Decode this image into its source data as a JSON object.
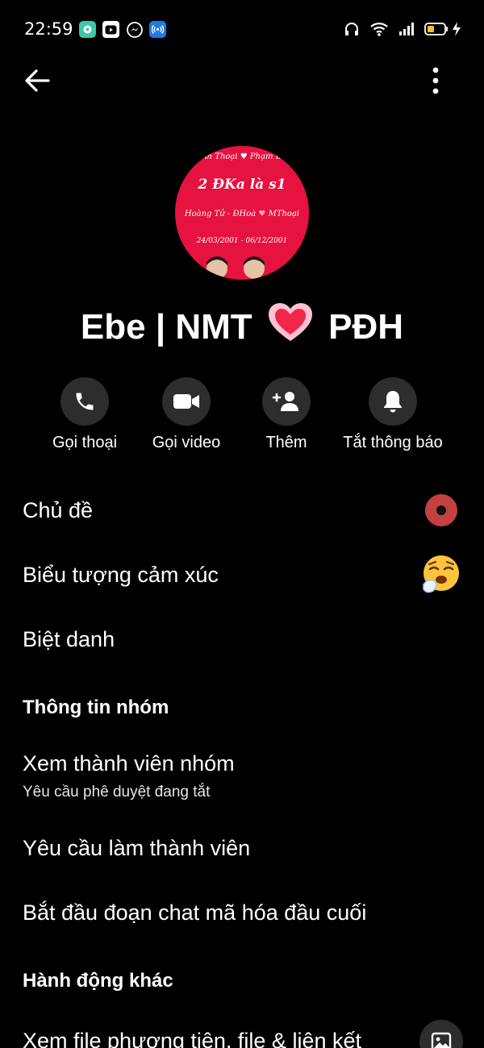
{
  "status_bar": {
    "time": "22:59",
    "notification_icons": [
      "chat-app-icon",
      "youtube-icon",
      "messenger-icon",
      "hotspot-icon"
    ],
    "system_icons": [
      "headphones-icon",
      "wifi-icon",
      "signal-icon",
      "battery-icon",
      "charging-icon"
    ]
  },
  "header": {
    "back_icon": "arrow-left-icon",
    "more_icon": "more-vertical-icon"
  },
  "avatar": {
    "lines": [
      "nh Thoại",
      "Phạm Đ",
      "2 ĐKa là s1",
      "Hoàng Tử - ĐHoà",
      "MThoại",
      "24/03/2001 - 06/12/2001"
    ]
  },
  "group": {
    "name_left": "Ebe | NMT",
    "name_right": "PĐH"
  },
  "actions": [
    {
      "label": "Gọi thoại",
      "icon": "phone-icon"
    },
    {
      "label": "Gọi video",
      "icon": "video-icon"
    },
    {
      "label": "Thêm",
      "icon": "add-person-icon"
    },
    {
      "label": "Tắt thông báo",
      "icon": "bell-icon"
    }
  ],
  "settings": {
    "theme": "Chủ đề",
    "emoji": "Biểu tượng cảm xúc",
    "nicknames": "Biệt danh"
  },
  "group_info": {
    "heading": "Thông tin nhóm",
    "view_members": "Xem thành viên nhóm",
    "view_members_sub": "Yêu cầu phê duyệt đang tắt",
    "member_requests": "Yêu cầu làm thành viên",
    "encrypted_chat": "Bắt đầu đoạn chat mã hóa đầu cuối"
  },
  "other_actions": {
    "heading": "Hành động khác",
    "view_media": "Xem file phương tiện, file & liên kết"
  },
  "colors": {
    "background": "#000000",
    "button_circle": "#2d2d2d",
    "theme_color": "#c2403f",
    "avatar_red": "#e6123f",
    "battery_yellow": "#f4c430"
  }
}
